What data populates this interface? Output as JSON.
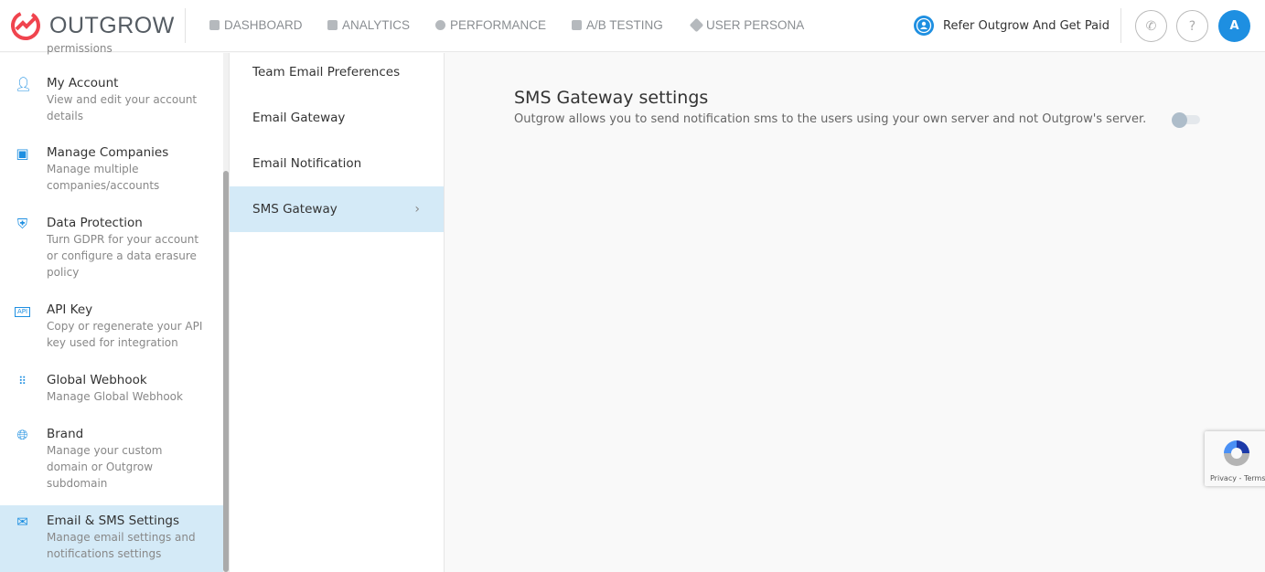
{
  "header": {
    "logo": "OUTGROW",
    "nav": [
      {
        "label": "DASHBOARD",
        "icon": "dashboard-icon"
      },
      {
        "label": "ANALYTICS",
        "icon": "bar-chart-icon"
      },
      {
        "label": "PERFORMANCE",
        "icon": "speedometer-icon"
      },
      {
        "label": "A/B TESTING",
        "icon": "ab-test-icon"
      },
      {
        "label": "USER PERSONA",
        "icon": "tags-icon"
      }
    ],
    "refer": "Refer Outgrow And Get Paid",
    "avatar": "A",
    "help": "?"
  },
  "sidebar": {
    "partial": "permissions",
    "items": [
      {
        "title": "My Account",
        "desc": "View and edit your account details",
        "icon": "user-icon"
      },
      {
        "title": "Manage Companies",
        "desc": "Manage multiple companies/accounts",
        "icon": "companies-icon"
      },
      {
        "title": "Data Protection",
        "desc": "Turn GDPR for your account or configure a data erasure policy",
        "icon": "shield-icon"
      },
      {
        "title": "API Key",
        "desc": "Copy or regenerate your API key used for integration",
        "icon": "api-icon"
      },
      {
        "title": "Global Webhook",
        "desc": "Manage Global Webhook",
        "icon": "webhook-icon"
      },
      {
        "title": "Brand",
        "desc": "Manage your custom domain or Outgrow subdomain",
        "icon": "globe-icon"
      },
      {
        "title": "Email & SMS Settings",
        "desc": "Manage email settings and notifications settings",
        "icon": "email-settings-icon",
        "active": true
      }
    ]
  },
  "submenu": [
    {
      "label": "Team Email Preferences"
    },
    {
      "label": "Email Gateway"
    },
    {
      "label": "Email Notification"
    },
    {
      "label": "SMS Gateway",
      "active": true
    }
  ],
  "main": {
    "title": "SMS Gateway settings",
    "desc": "Outgrow allows you to send notification sms to the users using your own server and not Outgrow's server.",
    "toggle_on": false
  },
  "recaptcha": {
    "links": "Privacy - Terms"
  },
  "colors": {
    "accent": "#1e8fe1",
    "active_bg": "#d4eaf7",
    "logo": "#f0444e"
  }
}
